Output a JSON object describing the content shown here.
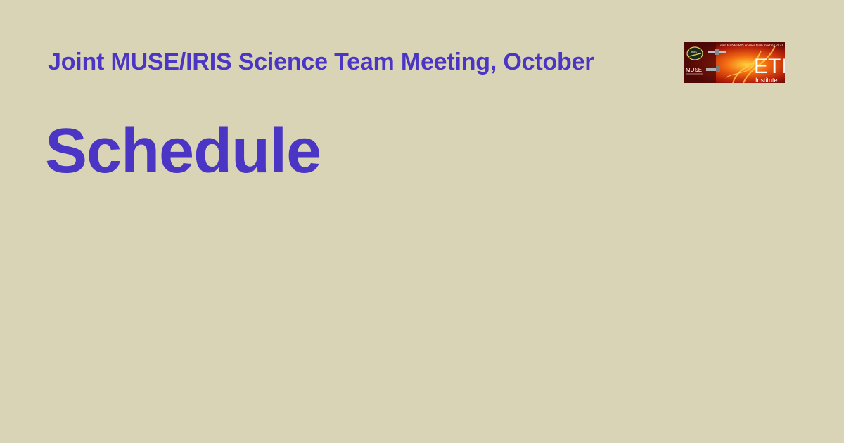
{
  "header": {
    "event_title": "Joint MUSE/IRIS Science Team Meeting, October"
  },
  "main": {
    "page_title": "Schedule"
  },
  "banner": {
    "caption": "Joint MUSE/IRIS science team meeting 2023",
    "logo_text": "ETI",
    "logo_subtext": "Institute",
    "mission_text": "MUSE",
    "badge_text": "IRIS"
  },
  "colors": {
    "background": "#dad4b6",
    "accent": "#4a35c4"
  }
}
